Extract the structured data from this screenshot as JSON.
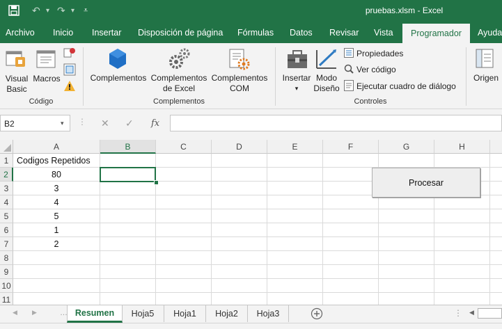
{
  "window": {
    "title": "pruebas.xlsm  -  Excel"
  },
  "ribbon_tabs": [
    "Archivo",
    "Inicio",
    "Insertar",
    "Disposición de página",
    "Fórmulas",
    "Datos",
    "Revisar",
    "Vista",
    "Programador",
    "Ayuda"
  ],
  "active_tab": "Programador",
  "groups": {
    "codigo": {
      "label": "Código",
      "visual_basic": "Visual\nBasic",
      "macros": "Macros"
    },
    "complementos": {
      "label": "Complementos",
      "complementos": "Complementos",
      "excel_addins": "Complementos\nde Excel",
      "com_addins": "Complementos\nCOM"
    },
    "controles": {
      "label": "Controles",
      "insertar": "Insertar",
      "modo_diseno": "Modo\nDiseño",
      "propiedades": "Propiedades",
      "ver_codigo": "Ver código",
      "ejecutar": "Ejecutar cuadro de diálogo"
    },
    "xml": {
      "origen": "Origen"
    }
  },
  "formula_bar": {
    "name_box": "B2",
    "fx": "fx",
    "formula": ""
  },
  "columns": [
    "A",
    "B",
    "C",
    "D",
    "E",
    "F",
    "G",
    "H"
  ],
  "rows": [
    "1",
    "2",
    "3",
    "4",
    "5",
    "6",
    "7",
    "8",
    "9",
    "10",
    "11"
  ],
  "selected_cell": "B2",
  "cells": {
    "A1": "Codigos Repetidos",
    "A2": "80",
    "A3": "3",
    "A4": "4",
    "A5": "5",
    "A6": "1",
    "A7": "2"
  },
  "form_button": {
    "label": "Procesar"
  },
  "sheets": [
    "Resumen",
    "Hoja5",
    "Hoja1",
    "Hoja2",
    "Hoja3"
  ],
  "active_sheet": "Resumen",
  "colors": {
    "accent": "#217346",
    "ribbon_bg": "#f3f3f3"
  }
}
